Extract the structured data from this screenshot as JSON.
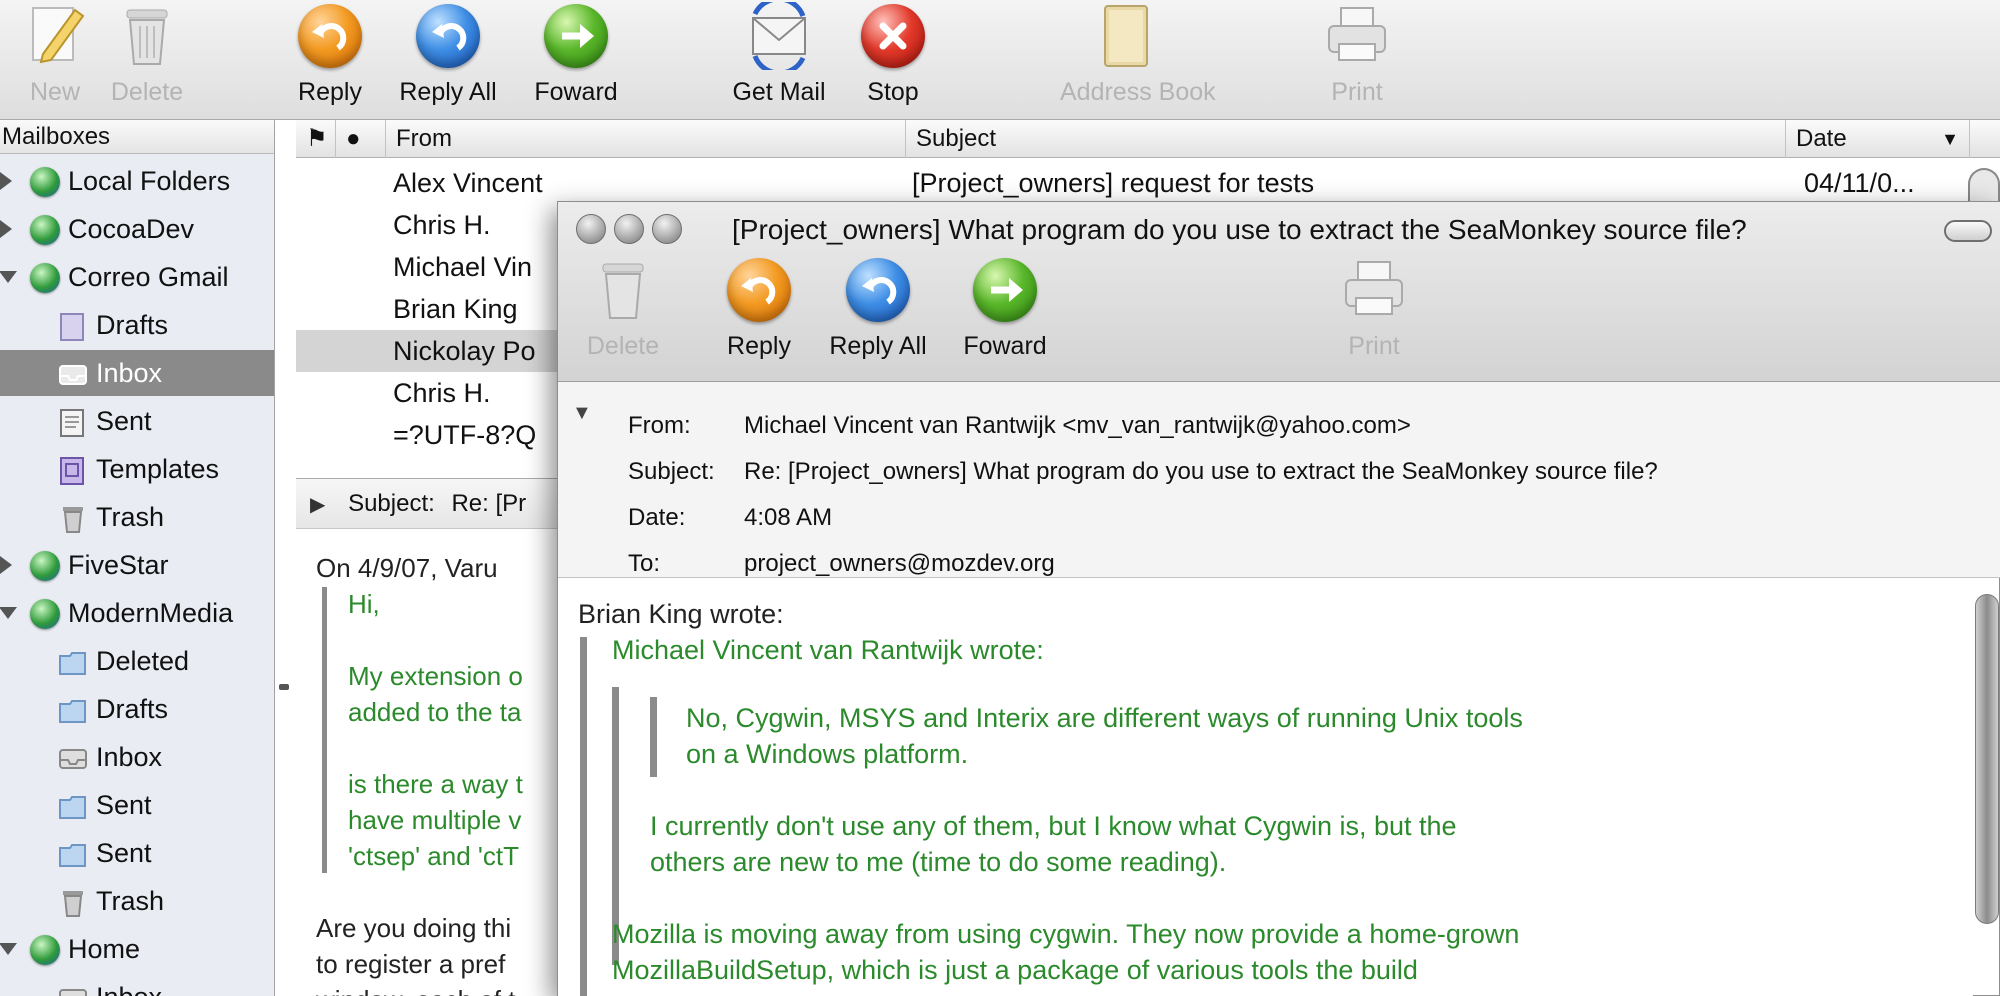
{
  "toolbar": {
    "new": "New",
    "delete": "Delete",
    "reply": "Reply",
    "reply_all": "Reply All",
    "forward": "Foward",
    "get_mail": "Get Mail",
    "stop": "Stop",
    "address_book": "Address Book",
    "print": "Print"
  },
  "sidebar": {
    "header": "Mailboxes",
    "items": [
      {
        "label": "Local Folders",
        "icon": "globe-icon"
      },
      {
        "label": "CocoaDev",
        "icon": "globe-icon"
      },
      {
        "label": "Correo Gmail",
        "icon": "globe-icon"
      },
      {
        "label": "Drafts",
        "icon": "drafts-folder-icon"
      },
      {
        "label": "Inbox",
        "icon": "inbox-folder-icon"
      },
      {
        "label": "Sent",
        "icon": "sent-folder-icon"
      },
      {
        "label": "Templates",
        "icon": "templates-folder-icon"
      },
      {
        "label": "Trash",
        "icon": "trash-icon"
      },
      {
        "label": "FiveStar",
        "icon": "globe-icon"
      },
      {
        "label": "ModernMedia",
        "icon": "globe-icon"
      },
      {
        "label": "Deleted",
        "icon": "folder-icon"
      },
      {
        "label": "Drafts",
        "icon": "folder-icon"
      },
      {
        "label": "Inbox",
        "icon": "inbox-folder-icon"
      },
      {
        "label": "Sent",
        "icon": "folder-icon"
      },
      {
        "label": "Sent",
        "icon": "folder-icon"
      },
      {
        "label": "Trash",
        "icon": "trash-icon"
      },
      {
        "label": "Home",
        "icon": "globe-icon"
      },
      {
        "label": "Inbox",
        "icon": "inbox-folder-icon"
      }
    ]
  },
  "message_list": {
    "columns": {
      "from": "From",
      "subject": "Subject",
      "date": "Date"
    },
    "rows": [
      {
        "from": "Alex Vincent",
        "subject": "[Project_owners] request for tests",
        "date": "04/11/0..."
      },
      {
        "from": "Chris H.",
        "subject": "",
        "date": ""
      },
      {
        "from": "Michael Vin",
        "subject": "",
        "date": ""
      },
      {
        "from": "Brian King",
        "subject": "",
        "date": ""
      },
      {
        "from": "Nickolay Po",
        "subject": "",
        "date": ""
      },
      {
        "from": "Chris H.",
        "subject": "",
        "date": ""
      },
      {
        "from": "=?UTF-8?Q",
        "subject": "",
        "date": ""
      }
    ]
  },
  "preview": {
    "subject_label": "Subject:",
    "subject_value": "Re: [Pr",
    "lines": [
      "On 4/9/07, Varu",
      "Hi,",
      "My extension o",
      "added to the ta",
      "is there a way t",
      "have multiple v",
      "'ctsep' and 'ctT",
      "Are you doing thi",
      "to register a pref",
      "window, each of t"
    ]
  },
  "message_window": {
    "title": "[Project_owners] What program do you use to extract the SeaMonkey source file?",
    "toolbar": {
      "delete": "Delete",
      "reply": "Reply",
      "reply_all": "Reply All",
      "forward": "Foward",
      "print": "Print"
    },
    "headers": {
      "from_label": "From:",
      "from_value": "Michael Vincent van Rantwijk <mv_van_rantwijk@yahoo.com>",
      "subject_label": "Subject:",
      "subject_value": "Re: [Project_owners] What program do you use to extract the SeaMonkey source file?",
      "date_label": "Date:",
      "date_value": "4:08 AM",
      "to_label": "To:",
      "to_value": "project_owners@mozdev.org"
    },
    "body": {
      "line1": "Brian King wrote:",
      "line2": "Michael Vincent van Rantwijk wrote:",
      "line3": "No, Cygwin, MSYS and Interix are different ways of running Unix tools",
      "line4": "on a Windows platform.",
      "line5": "I currently don't use any of them, but I know what Cygwin is, but the",
      "line6": "others are new to me (time to do some reading).",
      "line7": "Mozilla is moving away from using cygwin. They now provide a home-grown",
      "line8": "MozillaBuildSetup, which is just a package of various tools the build"
    }
  },
  "colors": {
    "quote_text": "#2b8a2b",
    "selection": "#8a8a8a",
    "sidebar_bg": "#e9edf3"
  }
}
